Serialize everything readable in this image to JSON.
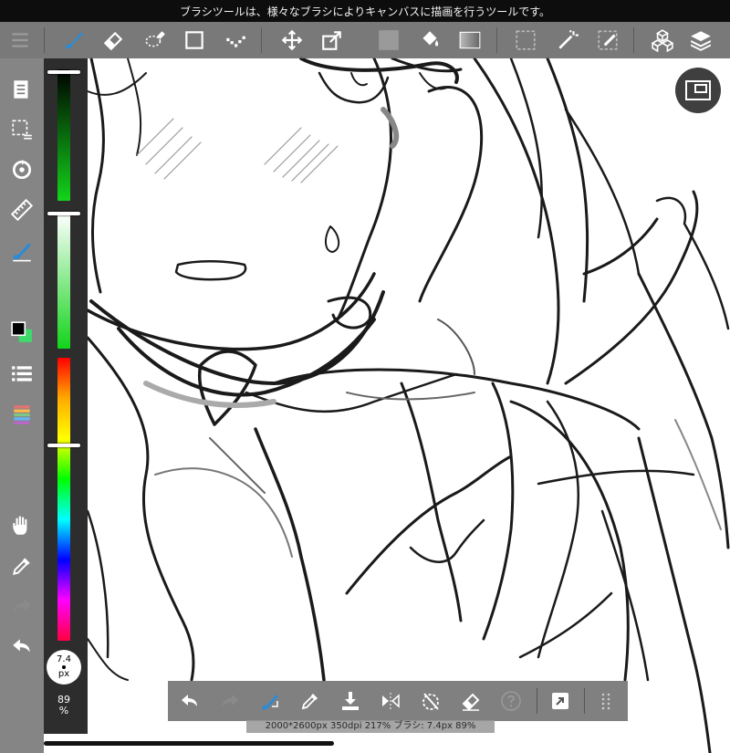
{
  "tip": {
    "text": "ブラシツールは、様々なブラシによりキャンバスに描画を行うツールです。"
  },
  "toolbar": {
    "tools": [
      {
        "name": "menu-icon",
        "active": false
      },
      {
        "name": "brush-tool-icon",
        "active": true
      },
      {
        "name": "eraser-tool-icon",
        "active": false
      },
      {
        "name": "lasso-eraser-icon",
        "active": false
      },
      {
        "name": "shape-tool-icon",
        "active": false
      },
      {
        "name": "dot-tool-icon",
        "active": false
      },
      {
        "name": "move-tool-icon",
        "active": false
      },
      {
        "name": "transform-tool-icon",
        "active": false
      },
      {
        "name": "fill-color-icon",
        "active": false
      },
      {
        "name": "bucket-tool-icon",
        "active": false
      },
      {
        "name": "gradient-tool-icon",
        "active": false
      },
      {
        "name": "select-tool-icon",
        "active": false
      },
      {
        "name": "magic-wand-icon",
        "active": false
      },
      {
        "name": "select-pen-icon",
        "active": false
      },
      {
        "name": "material-icon",
        "active": false
      },
      {
        "name": "layers-icon",
        "active": false
      }
    ]
  },
  "sidebar": {
    "items": [
      "pages-icon",
      "select-layer-icon",
      "rotate-icon",
      "ruler-icon",
      "brush-settings-icon",
      "color-swatch-icon",
      "layer-list-icon",
      "palette-icon",
      "hand-icon",
      "eyedropper-icon",
      "redo-icon",
      "undo-icon"
    ]
  },
  "colors": {
    "foreground": "#000000",
    "background": "#3ddc6a",
    "accent": "#2b8bd6"
  },
  "brush": {
    "size_value": "7.4",
    "size_unit": "px",
    "opacity_value": "89",
    "opacity_unit": "%",
    "lightness_level": 0.02,
    "saturation_level": 0.0,
    "hue_level": 0.31
  },
  "bottombar": {
    "buttons": [
      "undo-icon",
      "redo-icon",
      "transform-brush-icon",
      "eyedropper-icon",
      "save-icon",
      "flip-icon",
      "rotate-reset-icon",
      "eraser-toggle-icon",
      "help-icon",
      "share-icon",
      "grid-menu-icon"
    ]
  },
  "status": {
    "text": "2000*2600px 350dpi 217% ブラシ: 7.4px 89%"
  }
}
